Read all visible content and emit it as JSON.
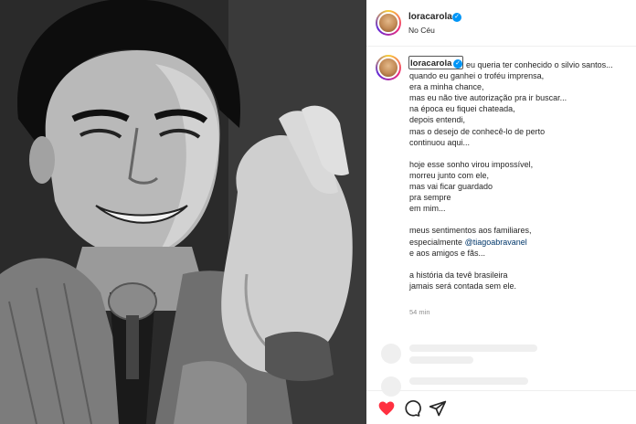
{
  "post": {
    "username": "loracarola",
    "location": "No Céu",
    "timestamp": "54 min"
  },
  "caption": {
    "username": "loracarola",
    "lines": [
      "eu queria ter conhecido o silvio santos...",
      "quando eu ganhei o troféu imprensa,",
      "era a minha chance,",
      "mas eu não tive autorização pra ir buscar...",
      "na época eu fiquei chateada,",
      "depois entendi,",
      "mas o desejo de conhecê-lo de perto",
      "continuou aqui...",
      "hoje esse sonho virou impossível,",
      "morreu junto com ele,",
      "mas vai ficar guardado",
      "pra sempre",
      "em mim...",
      "meus sentimentos aos familiares,",
      "especialmente",
      "@tiagoabravanel",
      "e aos amigos e fãs...",
      "a história da tevê brasileira",
      "jamais será contada sem ele."
    ]
  },
  "icons": {
    "verified": "verified-badge-icon",
    "like": "heart-icon",
    "comment": "comment-icon",
    "share": "share-icon"
  },
  "colors": {
    "like": "#ff3040",
    "verified": "#0095f6",
    "mention": "#00376b"
  }
}
